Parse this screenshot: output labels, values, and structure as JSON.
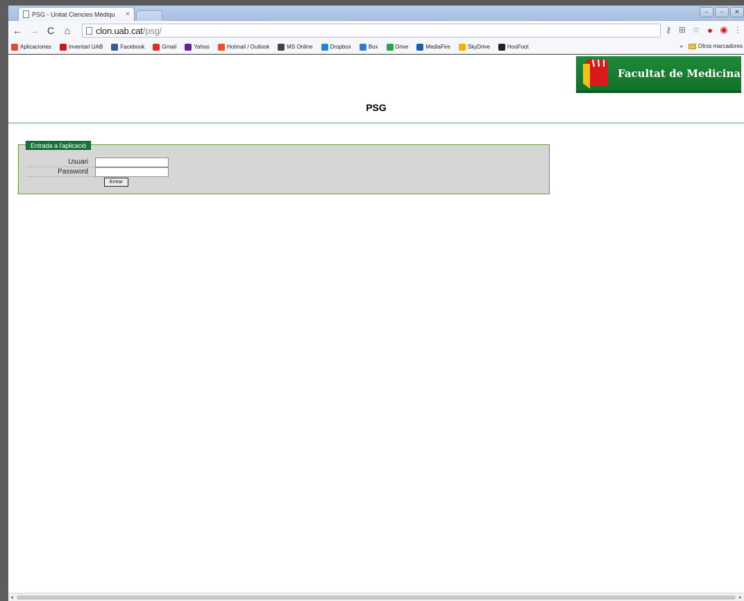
{
  "browser": {
    "tab_title": "PSG - Unitat Ciencies Mèdiqu",
    "tab_close": "×",
    "url_host": "clon.uab.cat",
    "url_path": "/psg/",
    "window_buttons": [
      "–",
      "▫",
      "✕"
    ]
  },
  "bookmarks": [
    {
      "label": "Aplicaciones",
      "color": "#e04a3a"
    },
    {
      "label": "Inventari UAB",
      "color": "#c81818"
    },
    {
      "label": "Facebook",
      "color": "#3b5998"
    },
    {
      "label": "Gmail",
      "color": "#d93025"
    },
    {
      "label": "Yahoo",
      "color": "#6a1fa0"
    },
    {
      "label": "Hotmail / Outlook",
      "color": "#f25022"
    },
    {
      "label": "MS Online",
      "color": "#444444"
    },
    {
      "label": "Dropbox",
      "color": "#1e84d6"
    },
    {
      "label": "Box",
      "color": "#2a7bd0"
    },
    {
      "label": "Drive",
      "color": "#2ba24c"
    },
    {
      "label": "MediaFire",
      "color": "#1760b8"
    },
    {
      "label": "SkyDrive",
      "color": "#f3b000"
    },
    {
      "label": "HooFoot",
      "color": "#222222"
    }
  ],
  "bookmarks_overflow": "»",
  "bookmarks_other": "Otros marcadores",
  "page": {
    "logo_text": "Facultat de Medicina",
    "title": "PSG",
    "form": {
      "legend": "Entrada a l'aplicació",
      "user_label": "Usuari",
      "password_label": "Password",
      "user_value": "",
      "password_value": "",
      "submit_label": "Entrar"
    }
  },
  "colors": {
    "brand_green": "#12763a",
    "logo_red": "#d81a1a",
    "form_bg": "#d6d6d6",
    "form_border": "#5d9a26"
  }
}
